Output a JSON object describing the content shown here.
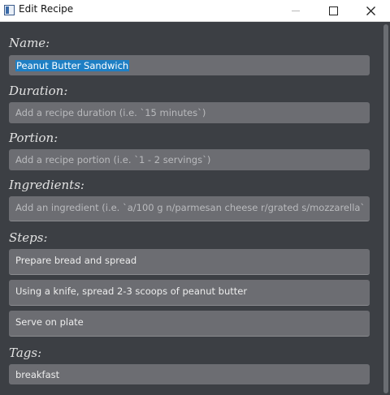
{
  "window": {
    "title": "Edit Recipe"
  },
  "form": {
    "name": {
      "label": "Name:",
      "value": "Peanut Butter Sandwich"
    },
    "duration": {
      "label": "Duration:",
      "placeholder": "Add a recipe duration (i.e. `15 minutes`)"
    },
    "portion": {
      "label": "Portion:",
      "placeholder": "Add a recipe portion (i.e. `1 - 2 servings`)"
    },
    "ingredients": {
      "label": "Ingredients:",
      "placeholder": "Add an ingredient (i.e. `a/100 g n/parmesan cheese r/grated s/mozzarella`"
    },
    "steps": {
      "label": "Steps:",
      "items": [
        "Prepare bread and spread",
        "Using a knife, spread 2-3 scoops of peanut butter",
        "Serve on plate"
      ]
    },
    "tags": {
      "label": "Tags:",
      "items": [
        "breakfast"
      ]
    }
  },
  "icons": {
    "app": "app-window-icon",
    "minimize": "minimize-icon",
    "maximize": "maximize-icon",
    "close": "close-icon"
  }
}
